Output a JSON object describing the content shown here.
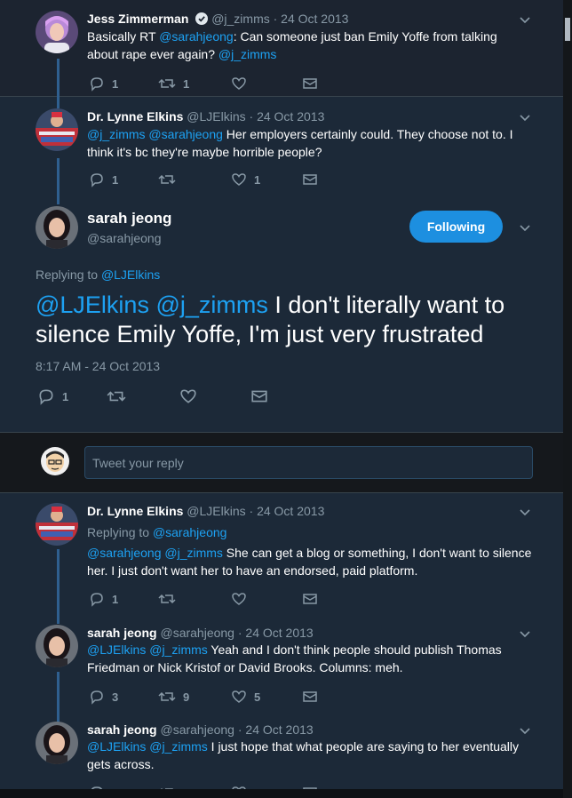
{
  "tweets": [
    {
      "name": "Jess Zimmerman",
      "verified": true,
      "handle": "@j_zimms",
      "date": " · 24 Oct 2013",
      "text_plain_1": "Basically RT ",
      "text_link_1": "@sarahjeong",
      "text_plain_2": ": Can someone just ban Emily Yoffe from talking about rape ever again? ",
      "text_link_2": "@j_zimms",
      "reply_count": "1",
      "retweet_count": "1",
      "like_count": ""
    },
    {
      "name": "Dr. Lynne Elkins",
      "handle": "@LJElkins",
      "date": " · 24 Oct 2013",
      "text_link_1": "@j_zimms @sarahjeong",
      "text_plain_1": " Her employers certainly could. They choose not to. I think it's bc they're maybe horrible people?",
      "reply_count": "1",
      "retweet_count": "",
      "like_count": "1"
    }
  ],
  "main_tweet": {
    "name": "sarah jeong",
    "handle": "@sarahjeong",
    "follow_label": "Following",
    "replying_label": "Replying to ",
    "replying_handle": "@LJElkins",
    "text_link": "@LJElkins @j_zimms",
    "text_plain": " I don't literally want to silence Emily Yoffe, I'm just very frustrated",
    "timestamp": "8:17 AM - 24 Oct 2013",
    "reply_count": "1"
  },
  "reply_composer": {
    "placeholder": "Tweet your reply"
  },
  "replies": [
    {
      "name": "Dr. Lynne Elkins",
      "handle": "@LJElkins",
      "date": " · 24 Oct 2013",
      "replying_label": "Replying to ",
      "replying_handle": "@sarahjeong",
      "text_link": "@sarahjeong @j_zimms",
      "text_plain": " She can get a blog or something, I don't want to silence her. I just don't want her to have an endorsed, paid platform.",
      "reply_count": "1",
      "retweet_count": "",
      "like_count": ""
    },
    {
      "name": "sarah jeong",
      "handle": "@sarahjeong",
      "date": " · 24 Oct 2013",
      "text_link": "@LJElkins @j_zimms",
      "text_plain": " Yeah and I don't think people should publish Thomas Friedman or Nick Kristof or David Brooks. Columns: meh.",
      "reply_count": "3",
      "retweet_count": "9",
      "like_count": "5"
    },
    {
      "name": "sarah jeong",
      "handle": "@sarahjeong",
      "date": " · 24 Oct 2013",
      "text_link": "@LJElkins @j_zimms",
      "text_plain": " I just hope that what people are saying to her eventually gets across."
    }
  ],
  "colors": {
    "background": "#1c2938",
    "link": "#1da1f2",
    "muted": "#8899a6",
    "follow_button": "#1d8fe0"
  }
}
